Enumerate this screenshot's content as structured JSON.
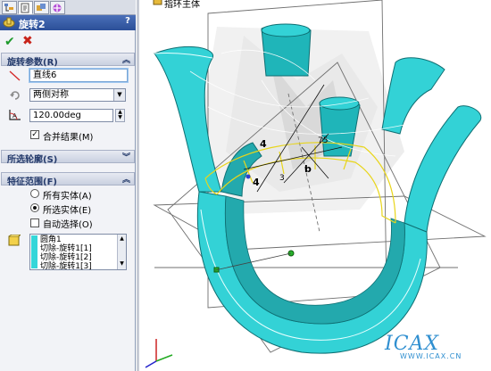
{
  "panel": {
    "tabs": [
      "feature-manager-tab",
      "property-manager-tab",
      "configuration-manager-tab",
      "dimxpert-tab"
    ],
    "feature_title": "旋转2",
    "help": "?",
    "rotate_params": {
      "header": "旋转参数(R)",
      "axis_value": "直线6",
      "type_value": "两侧对称",
      "angle_value": "120.00deg",
      "merge_label": "合并结果(M)",
      "merge_checked": true
    },
    "selected_contours": {
      "header": "所选轮廓(S)"
    },
    "feature_scope": {
      "header": "特征范围(F)",
      "options": [
        "所有实体(A)",
        "所选实体(E)"
      ],
      "selected_option": "所选实体(E)",
      "auto_select_label": "自动选择(O)",
      "bodies": [
        "圆角1",
        "切除-旋转1[1]",
        "切除-旋转1[2]",
        "切除-旋转1[3]"
      ]
    }
  },
  "viewport": {
    "tree_label": "指环主体",
    "watermark": "ICAX",
    "watermark_sub": "WWW.ICAX.CN",
    "dimension_labels": [
      "4",
      "b",
      "4",
      "3",
      "75"
    ],
    "colors": {
      "ring": "#33d2d6",
      "ring_dark": "#1d8d91",
      "sketch": "#e8d51a",
      "plane": "#6f6f6f",
      "watermark": "#2f8fd0"
    }
  }
}
